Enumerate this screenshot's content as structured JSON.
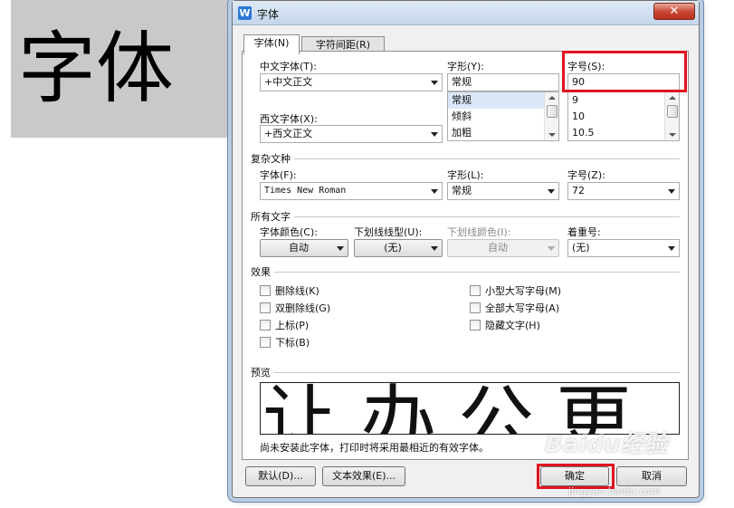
{
  "document": {
    "text": "字体"
  },
  "dialog": {
    "title": "字体",
    "app_icon": "W",
    "close_glyph": "✕",
    "tabs": [
      {
        "label": "字体(N)",
        "active": true
      },
      {
        "label": "字符间距(R)",
        "active": false
      }
    ],
    "cn_font": {
      "label": "中文字体(T):",
      "value": "+中文正文"
    },
    "style": {
      "label": "字形(Y):",
      "value": "常规",
      "options": [
        "常规",
        "倾斜",
        "加粗"
      ]
    },
    "size": {
      "label": "字号(S):",
      "value": "90",
      "options": [
        "9",
        "10",
        "10.5"
      ]
    },
    "west_font": {
      "label": "西文字体(X):",
      "value": "+西文正文"
    },
    "complex": {
      "group_title": "复杂文种",
      "font_label": "字体(F):",
      "font_value": "Times New Roman",
      "style_label": "字形(L):",
      "style_value": "常规",
      "size_label": "字号(Z):",
      "size_value": "72"
    },
    "all_text": {
      "group_title": "所有文字",
      "color_label": "字体颜色(C):",
      "color_value": "自动",
      "underline_label": "下划线线型(U):",
      "underline_value": "(无)",
      "underline_color_label": "下划线颜色(I):",
      "underline_color_value": "自动",
      "emphasis_label": "着重号:",
      "emphasis_value": "(无)"
    },
    "effects": {
      "group_title": "效果",
      "left": [
        "删除线(K)",
        "双删除线(G)",
        "上标(P)",
        "下标(B)"
      ],
      "right": [
        "小型大写字母(M)",
        "全部大写字母(A)",
        "隐藏文字(H)"
      ]
    },
    "preview": {
      "group_title": "预览",
      "sample_text": "让办公更",
      "note": "尚未安装此字体，打印时将采用最相近的有效字体。"
    },
    "buttons": {
      "default": "默认(D)...",
      "text_effects": "文本效果(E)...",
      "ok": "确定",
      "cancel": "取消"
    }
  },
  "watermark": {
    "logo": "Baidu经验",
    "url": "jingyan.baidu.com"
  },
  "colors": {
    "highlight": "#e0141e",
    "selection": "#dce8f8",
    "title_bar": "#c5d6ec"
  }
}
